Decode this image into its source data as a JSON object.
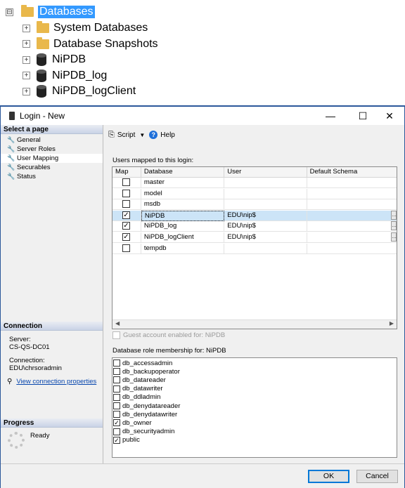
{
  "tree": {
    "root": {
      "label": "Databases",
      "expander": "⊟"
    },
    "children": [
      {
        "label": "System Databases",
        "icon": "folder-icon"
      },
      {
        "label": "Database Snapshots",
        "icon": "folder-icon"
      },
      {
        "label": "NiPDB",
        "icon": "database-icon"
      },
      {
        "label": "NiPDB_log",
        "icon": "database-icon"
      },
      {
        "label": "NiPDB_logClient",
        "icon": "database-icon"
      }
    ]
  },
  "window": {
    "title": "Login - New",
    "minimize": "—",
    "maximize": "☐",
    "close": "✕"
  },
  "left_pane": {
    "select_page_header": "Select a page",
    "pages": [
      "General",
      "Server Roles",
      "User Mapping",
      "Securables",
      "Status"
    ],
    "selected_page": "User Mapping",
    "connection_header": "Connection",
    "server_label": "Server:",
    "server_value": "CS-QS-DC01",
    "connection_label": "Connection:",
    "connection_value": "EDU\\chrsoradmin",
    "view_connection_link": "View connection properties",
    "progress_header": "Progress",
    "progress_status": "Ready"
  },
  "toolbar": {
    "script_label": "Script",
    "help_label": "Help"
  },
  "mapping": {
    "group_label": "Users mapped to this login:",
    "columns": [
      "Map",
      "Database",
      "User",
      "Default Schema"
    ],
    "rows": [
      {
        "checked": false,
        "database": "master",
        "user": "",
        "schema": ""
      },
      {
        "checked": false,
        "database": "model",
        "user": "",
        "schema": ""
      },
      {
        "checked": false,
        "database": "msdb",
        "user": "",
        "schema": ""
      },
      {
        "checked": true,
        "database": "NiPDB",
        "user": "EDU\\nip$",
        "schema": "",
        "selected": true
      },
      {
        "checked": true,
        "database": "NiPDB_log",
        "user": "EDU\\nip$",
        "schema": ""
      },
      {
        "checked": true,
        "database": "NiPDB_logClient",
        "user": "EDU\\nip$",
        "schema": ""
      },
      {
        "checked": false,
        "database": "tempdb",
        "user": "",
        "schema": ""
      }
    ]
  },
  "guest": {
    "label": "Guest account enabled for: NiPDB",
    "checked": false,
    "enabled": false
  },
  "roles": {
    "group_label": "Database role membership for: NiPDB",
    "items": [
      {
        "name": "db_accessadmin",
        "checked": false
      },
      {
        "name": "db_backupoperator",
        "checked": false
      },
      {
        "name": "db_datareader",
        "checked": false
      },
      {
        "name": "db_datawriter",
        "checked": false
      },
      {
        "name": "db_ddladmin",
        "checked": false
      },
      {
        "name": "db_denydatareader",
        "checked": false
      },
      {
        "name": "db_denydatawriter",
        "checked": false
      },
      {
        "name": "db_owner",
        "checked": true
      },
      {
        "name": "db_securityadmin",
        "checked": false
      },
      {
        "name": "public",
        "checked": true
      }
    ]
  },
  "buttons": {
    "ok": "OK",
    "cancel": "Cancel"
  }
}
